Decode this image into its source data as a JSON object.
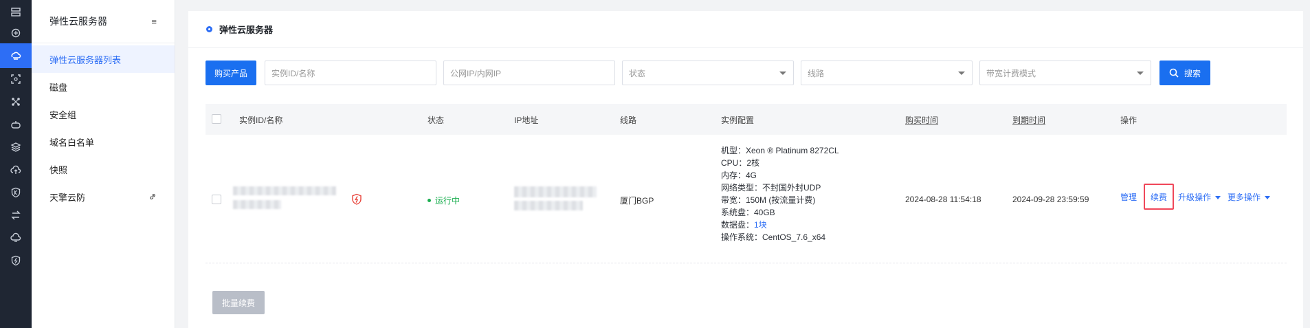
{
  "iconbar": {
    "items": [
      {
        "icon": "server-list-icon"
      },
      {
        "icon": "cdn-icon"
      },
      {
        "icon": "cloud-host-icon",
        "active": true
      },
      {
        "icon": "scan-icon"
      },
      {
        "icon": "network-icon"
      },
      {
        "icon": "cloud-game-icon"
      },
      {
        "icon": "layers-icon"
      },
      {
        "icon": "cloud-upload-icon"
      },
      {
        "icon": "shield-k-icon"
      },
      {
        "icon": "transfer-icon"
      },
      {
        "icon": "cloud-sync-icon"
      },
      {
        "icon": "shield-bolt-icon"
      }
    ]
  },
  "subnav": {
    "title": "弹性云服务器",
    "collapse_icon": "≡",
    "items": [
      {
        "label": "弹性云服务器列表",
        "active": true
      },
      {
        "label": "磁盘"
      },
      {
        "label": "安全组"
      },
      {
        "label": "域名白名单"
      },
      {
        "label": "快照"
      },
      {
        "label": "天擎云防",
        "external": true
      }
    ]
  },
  "tab": {
    "label": "弹性云服务器"
  },
  "toolbar": {
    "buy_label": "购买产品",
    "instance_placeholder": "实例ID/名称",
    "ip_placeholder": "公网IP/内网IP",
    "status_placeholder": "状态",
    "line_placeholder": "线路",
    "billing_placeholder": "带宽计费模式",
    "search_label": "搜索"
  },
  "table": {
    "headers": {
      "instance": "实例ID/名称",
      "status": "状态",
      "ip": "IP地址",
      "line": "线路",
      "config": "实例配置",
      "purchase_time": "购买时间",
      "expire_time": "到期时间",
      "ops": "操作"
    },
    "rows": [
      {
        "status": "运行中",
        "line": "厦门BGP",
        "config": {
          "model": "机型：Xeon ® Platinum 8272CL",
          "cpu": "CPU：2核",
          "memory": "内存：4G",
          "net_type": "网络类型：不封国外封UDP",
          "bandwidth": "带宽：150M (按流量计费)",
          "system_disk": "系统盘：40GB",
          "data_disk_prefix": "数据盘：",
          "data_disk_link": "1块",
          "os": "操作系统：CentOS_7.6_x64"
        },
        "purchase_time": "2024-08-28 11:54:18",
        "expire_time": "2024-09-28 23:59:59",
        "ops": {
          "manage": "管理",
          "renew": "续费",
          "upgrade": "升级操作",
          "more": "更多操作"
        }
      }
    ]
  },
  "batch_renew_label": "批量续费",
  "colors": {
    "primary": "#1a6ff0",
    "running": "#1aae4f",
    "highlight": "#f0475a",
    "sidebar_dark": "#1f2633"
  }
}
